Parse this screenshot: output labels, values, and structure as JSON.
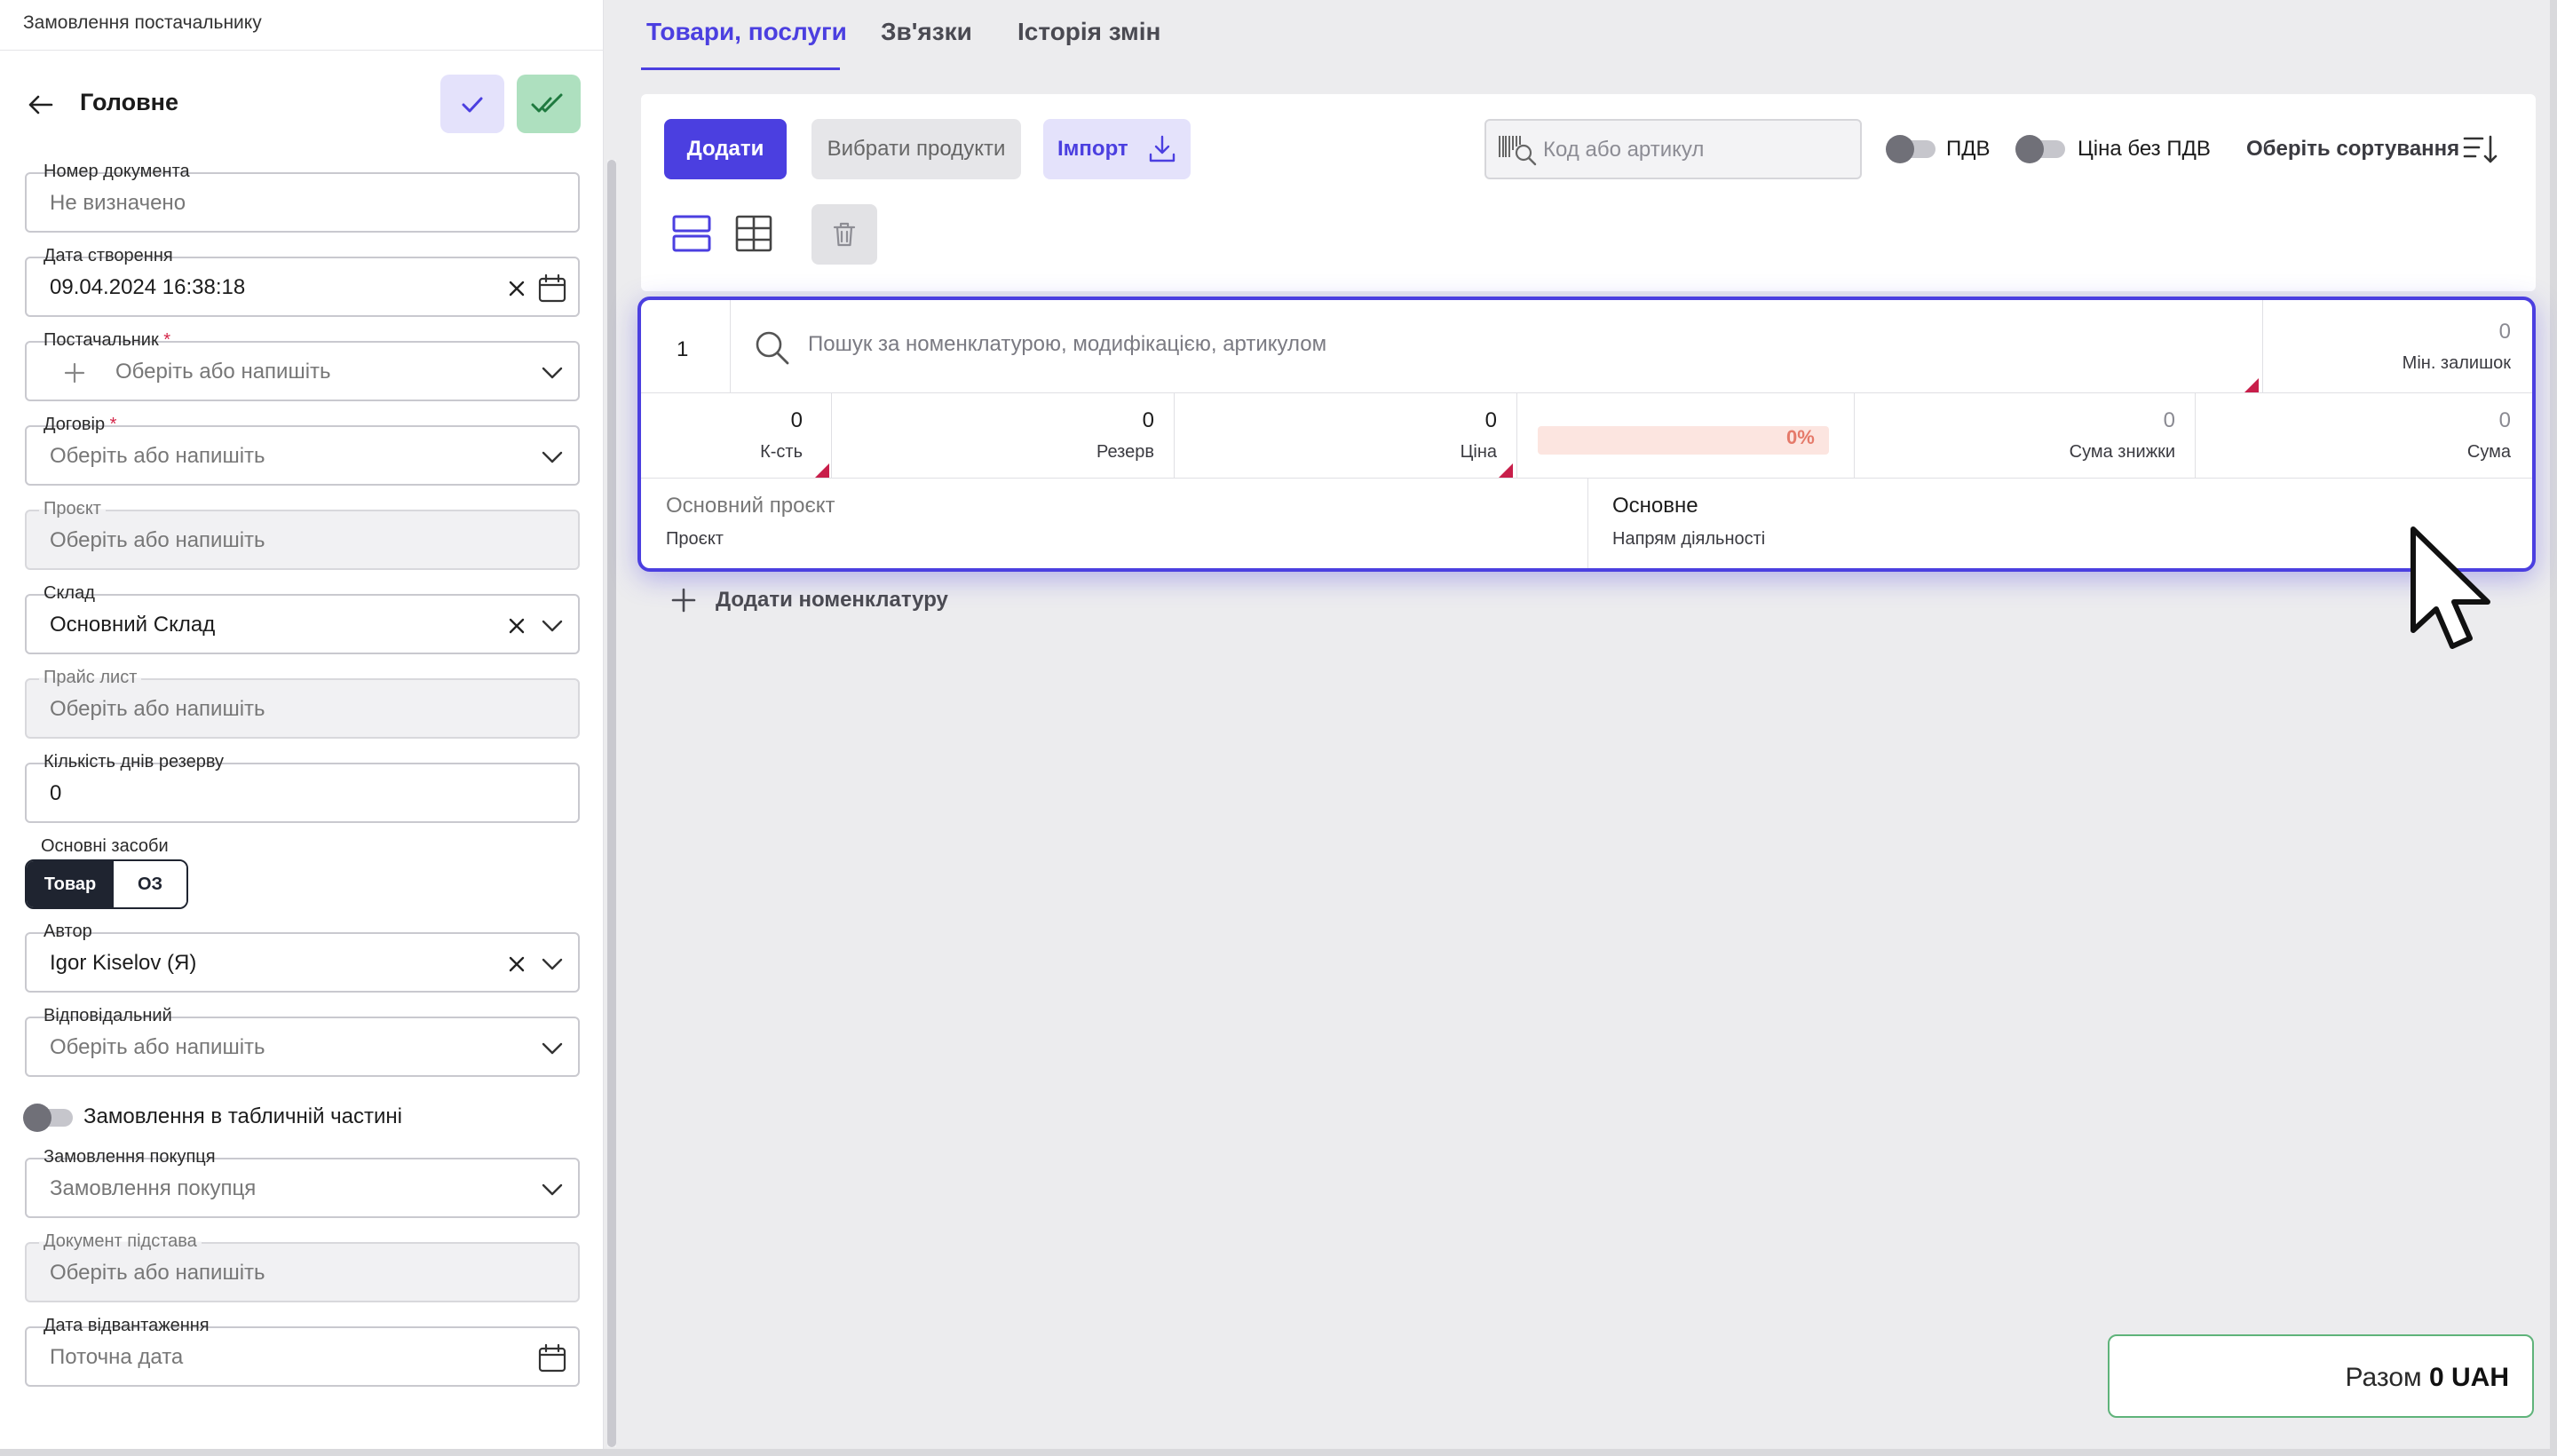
{
  "window": {
    "title": "Замовлення постачальнику"
  },
  "header": {
    "back_label": "",
    "title": "Головне"
  },
  "fields": {
    "doc_number": {
      "label": "Номер документа",
      "value": "Не визначено"
    },
    "created": {
      "label": "Дата створення",
      "value": "09.04.2024 16:38:18"
    },
    "supplier": {
      "label": "Постачальник",
      "required": "*",
      "value": "Оберіть або напишіть"
    },
    "contract": {
      "label": "Договір",
      "required": "*",
      "value": "Оберіть або напишіть"
    },
    "project": {
      "label": "Проєкт",
      "value": "Оберіть або напишіть"
    },
    "warehouse": {
      "label": "Склад",
      "value": "Основний Склад"
    },
    "price_list": {
      "label": "Прайс лист",
      "value": "Оберіть або напишіть"
    },
    "reserve_days": {
      "label": "Кількість днів резерву",
      "value": "0"
    },
    "fixed_assets": {
      "label": "Основні засоби",
      "option_on": "Товар",
      "option_off": "ОЗ"
    },
    "author": {
      "label": "Автор",
      "value": "Igor Kiselov (Я)"
    },
    "responsible": {
      "label": "Відповідальний",
      "value": "Оберіть або напишіть"
    },
    "table_order_toggle": {
      "label": "Замовлення в табличній частині"
    },
    "purchase_order": {
      "label": "Замовлення покупця",
      "value": "Замовлення покупця"
    },
    "base_doc": {
      "label": "Документ підстава",
      "value": "Оберіть або напишіть"
    },
    "ship_date": {
      "label": "Дата відвантаження",
      "value": "Поточна дата"
    }
  },
  "tabs": [
    "Товари, послуги",
    "Зв'язки",
    "Історія змін"
  ],
  "toolbar": {
    "add": "Додати",
    "choose_products": "Вибрати продукти",
    "import": "Імпорт",
    "code_placeholder": "Код або артикул",
    "vat": "ПДВ",
    "price_no_vat": "Ціна без ПДВ",
    "sort": "Оберіть сортування"
  },
  "product_row": {
    "number": "1",
    "search_placeholder": "Пошук за номенклатурою, модифікацією, артикулом",
    "min_stock": {
      "value": "0",
      "label": "Мін. залишок"
    },
    "qty": {
      "value": "0",
      "label": "К-сть"
    },
    "reserve": {
      "value": "0",
      "label": "Резерв"
    },
    "price": {
      "value": "0",
      "label": "Ціна"
    },
    "discount_pct": "0%",
    "discount_sum": {
      "value": "0",
      "label": "Сума знижки"
    },
    "sum": {
      "value": "0",
      "label": "Сума"
    },
    "project": {
      "value": "Основний проєкт",
      "label": "Проєкт"
    },
    "direction": {
      "value": "Основне",
      "label": "Напрям діяльності"
    }
  },
  "add_nomenclature": "Додати номенклатуру",
  "total": {
    "label": "Разом",
    "value": "0 UAH"
  },
  "colors": {
    "accent": "#4b3fe0",
    "success": "#aee0bf",
    "error": "#c81e4a"
  }
}
